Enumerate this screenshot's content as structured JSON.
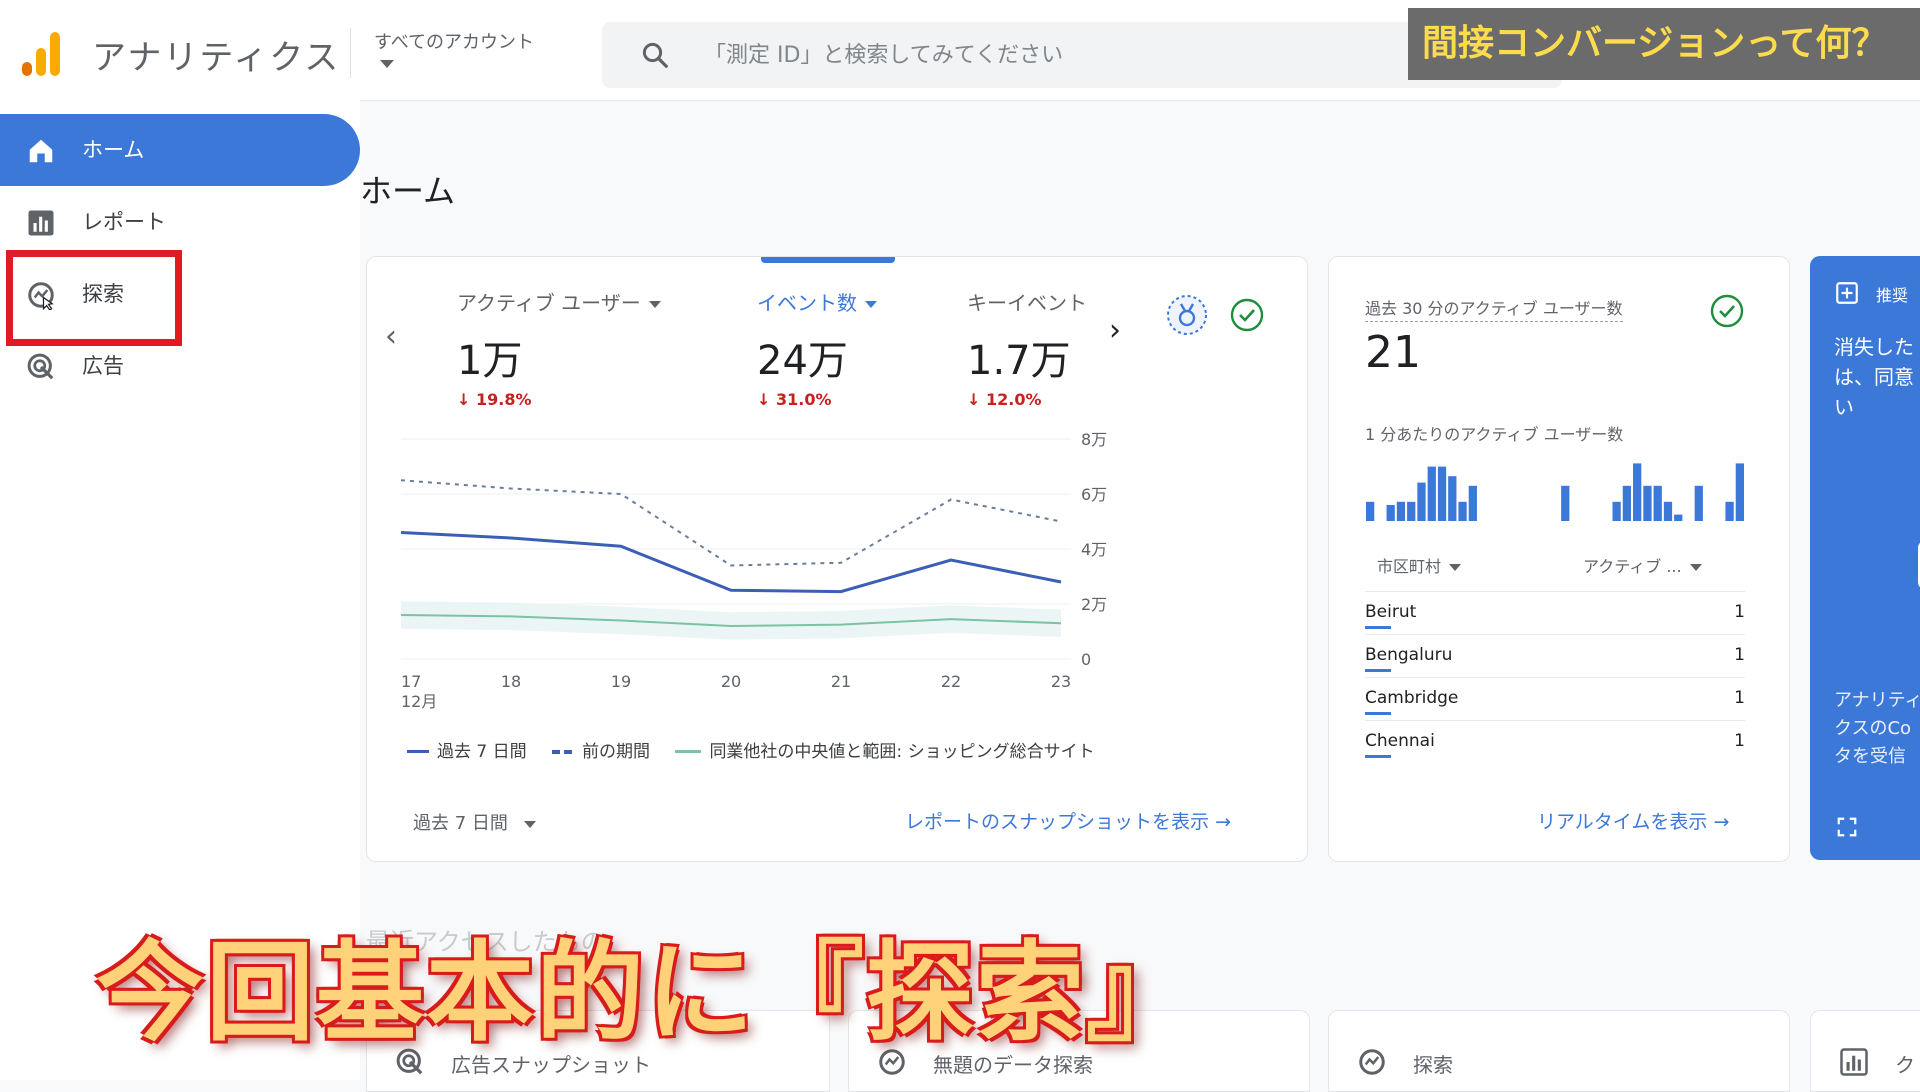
{
  "app": {
    "name": "アナリティクス",
    "account_label": "すべてのアカウント"
  },
  "search": {
    "placeholder": "「測定 ID」と検索してみてください"
  },
  "overlay_title": "間接コンバージョンって何？",
  "sidebar": {
    "items": [
      {
        "label": "ホーム",
        "icon": "home-icon",
        "active": true
      },
      {
        "label": "レポート",
        "icon": "bar-chart-icon"
      },
      {
        "label": "探索",
        "icon": "explore-icon",
        "highlighted": true
      },
      {
        "label": "広告",
        "icon": "ads-icon"
      }
    ]
  },
  "page": {
    "title": "ホーム"
  },
  "main_card": {
    "metrics": [
      {
        "label": "アクティブ ユーザー",
        "value": "1万",
        "change": "19.8%"
      },
      {
        "label": "イベント数",
        "value": "24万",
        "change": "31.0%",
        "active": true
      },
      {
        "label": "キーイベント",
        "value": "1.7万",
        "change": "12.0%"
      }
    ],
    "legend": [
      {
        "label": "過去 7 日間"
      },
      {
        "label": "前の期間"
      },
      {
        "label": "同業他社の中央値と範囲: ショッピング総合サイト"
      }
    ],
    "period_selector": "過去 7 日間",
    "link": "レポートのスナップショットを表示"
  },
  "chart_data": {
    "type": "line",
    "x": [
      "17",
      "18",
      "19",
      "20",
      "21",
      "22",
      "23"
    ],
    "x_sublabel": "12月",
    "y_ticks": [
      "0",
      "2万",
      "4万",
      "6万",
      "8万"
    ],
    "ylim": [
      0,
      80000
    ],
    "series": [
      {
        "name": "過去 7 日間",
        "values": [
          46000,
          44000,
          41000,
          25000,
          24500,
          36000,
          28000
        ],
        "color": "#3c5fb6"
      },
      {
        "name": "前の期間",
        "values": [
          65000,
          62000,
          60000,
          34000,
          35000,
          58000,
          50000
        ],
        "color": "#6b7d9a",
        "dashed": true
      },
      {
        "name": "同業他社の中央値と範囲: ショッピング総合サイト",
        "values": [
          16000,
          15500,
          14000,
          12000,
          12500,
          14500,
          13000
        ],
        "color": "#7cc2a3"
      }
    ],
    "grid": true
  },
  "realtime_card": {
    "label": "過去 30 分のアクティブ ユーザー数",
    "value": "21",
    "sub_label": "1 分あたりのアクティブ ユーザー数",
    "bars": [
      0.3,
      0,
      0.25,
      0.3,
      0.3,
      0.6,
      0.85,
      0.85,
      0.7,
      0.3,
      0.55,
      0,
      0,
      0,
      0,
      0,
      0,
      0,
      0,
      0.55,
      0,
      0,
      0,
      0,
      0.3,
      0.55,
      0.9,
      0.55,
      0.55,
      0.3,
      0.1,
      0,
      0.55,
      0,
      0,
      0.3,
      0.9
    ],
    "col_city": "市区町村",
    "col_active": "アクティブ ...",
    "rows": [
      {
        "city": "Beirut",
        "count": "1"
      },
      {
        "city": "Bengaluru",
        "count": "1"
      },
      {
        "city": "Cambridge",
        "count": "1"
      },
      {
        "city": "Chennai",
        "count": "1"
      }
    ],
    "link": "リアルタイムを表示"
  },
  "recommend_card": {
    "header": "推奨",
    "text_lines": [
      "消失した",
      "は、同意",
      "い"
    ],
    "footer_lines": [
      "アナリティ",
      "クスのCo",
      "タを受信"
    ]
  },
  "section_faded": "最近アクセスしたもの",
  "bottom_cards": [
    {
      "label": "広告スナップショット",
      "icon": "ads-icon"
    },
    {
      "label": "無題のデータ探索",
      "icon": "explore-icon"
    },
    {
      "label": "探索",
      "icon": "explore-icon"
    },
    {
      "label": "ク",
      "icon": "bar-chart-icon"
    }
  ],
  "caption": "今回基本的に『探索』",
  "colors": {
    "primary": "#3c78d8",
    "negative": "#c5221f",
    "highlight": "#e01b24",
    "caption": "#ffd27a"
  }
}
